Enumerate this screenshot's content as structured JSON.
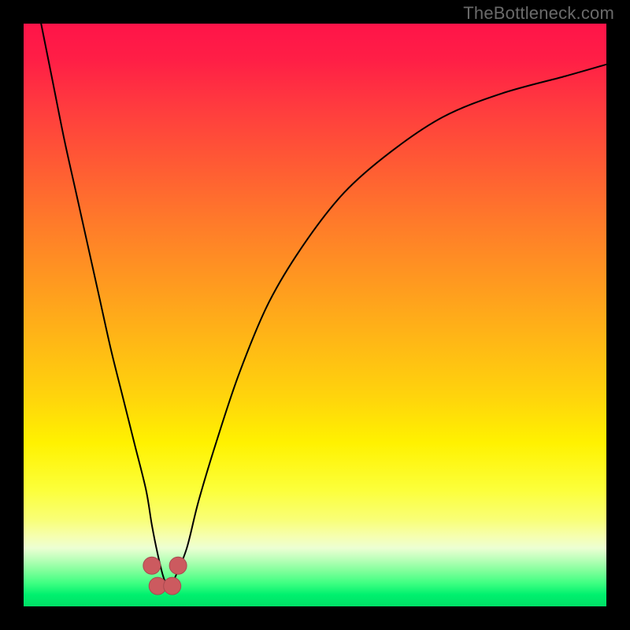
{
  "watermark": {
    "text": "TheBottleneck.com"
  },
  "frame": {
    "outer_width": 800,
    "outer_height": 800,
    "inner_left": 30,
    "inner_top": 30,
    "inner_width": 740,
    "inner_height": 740
  },
  "colors": {
    "background": "#000000",
    "gradient_top": "#ff1449",
    "gradient_mid": "#ffd400",
    "gradient_bottom": "#00e066",
    "curve": "#000000",
    "marker_fill": "#cc5a5f",
    "marker_stroke": "#a84a50"
  },
  "chart_data": {
    "type": "line",
    "title": "",
    "xlabel": "",
    "ylabel": "",
    "xlim": [
      0,
      100
    ],
    "ylim": [
      0,
      100
    ],
    "grid": false,
    "legend": null,
    "series": [
      {
        "name": "curve",
        "x": [
          3,
          5,
          7,
          9,
          11,
          13,
          15,
          17,
          19,
          21,
          22,
          23,
          24,
          25,
          26,
          28,
          30,
          33,
          37,
          42,
          48,
          55,
          63,
          72,
          82,
          93,
          100
        ],
        "y": [
          100,
          90,
          80,
          71,
          62,
          53,
          44,
          36,
          28,
          20,
          14,
          9,
          5,
          3,
          5,
          10,
          18,
          28,
          40,
          52,
          62,
          71,
          78,
          84,
          88,
          91,
          93
        ]
      }
    ],
    "markers": [
      {
        "x": 22.0,
        "y": 7.0
      },
      {
        "x": 23.0,
        "y": 3.5
      },
      {
        "x": 25.5,
        "y": 3.5
      },
      {
        "x": 26.5,
        "y": 7.0
      }
    ],
    "notes": "Values are percentage estimates read off the graphic; the curve is a V-shaped bottleneck profile dipping to ~3% at x≈24 and rising asymptotically toward ~93% on the right."
  }
}
